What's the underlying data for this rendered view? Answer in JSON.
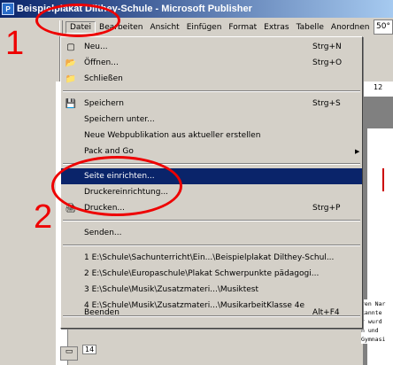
{
  "window": {
    "title": "Beispielplakat Dilthey-Schule - Microsoft Publisher",
    "icon": "publisher-icon"
  },
  "menubar": {
    "items": [
      "Datei",
      "Bearbeiten",
      "Ansicht",
      "Einfügen",
      "Format",
      "Extras",
      "Tabelle",
      "Anordnen"
    ],
    "zoom": "50°"
  },
  "file_menu": {
    "items": [
      {
        "label": "Neu...",
        "shortcut": "Strg+N",
        "icon": "new-icon"
      },
      {
        "label": "Öffnen...",
        "shortcut": "Strg+O",
        "icon": "open-folder-icon"
      },
      {
        "label": "Schließen",
        "shortcut": "",
        "icon": "close-folder-icon"
      },
      {
        "label": "Speichern",
        "shortcut": "Strg+S",
        "icon": "save-icon"
      },
      {
        "label": "Speichern unter...",
        "shortcut": ""
      },
      {
        "label": "Neue Webpublikation aus aktueller erstellen",
        "shortcut": ""
      },
      {
        "label": "Pack and Go",
        "shortcut": "",
        "submenu": true
      },
      {
        "label": "Seite einrichten...",
        "shortcut": "",
        "highlighted": true
      },
      {
        "label": "Druckereinrichtung...",
        "shortcut": ""
      },
      {
        "label": "Drucken...",
        "shortcut": "Strg+P",
        "icon": "print-icon"
      },
      {
        "label": "Senden...",
        "shortcut": ""
      },
      {
        "label": "1 E:\\Schule\\Sachunterricht\\Ein...\\Beispielplakat Dilthey-Schul...",
        "shortcut": ""
      },
      {
        "label": "2 E:\\Schule\\Europaschule\\Plakat Schwerpunkte pädagogi...",
        "shortcut": ""
      },
      {
        "label": "3 E:\\Schule\\Musik\\Zusatzmateri...\\Musiktest",
        "shortcut": ""
      },
      {
        "label": "4 E:\\Schule\\Musik\\Zusatzmateri...\\MusikarbeitKlasse 4e",
        "shortcut": ""
      },
      {
        "label": "Beenden",
        "shortcut": "Alt+F4"
      }
    ]
  },
  "annotations": {
    "one": "1",
    "two": "2",
    "color": "#e00000"
  },
  "background": {
    "ruler_mark": "12",
    "page_number": "14",
    "doc_text": [
      "ren Nar",
      "kannte",
      "r wurd",
      "n und",
      "Gymnasi"
    ]
  }
}
